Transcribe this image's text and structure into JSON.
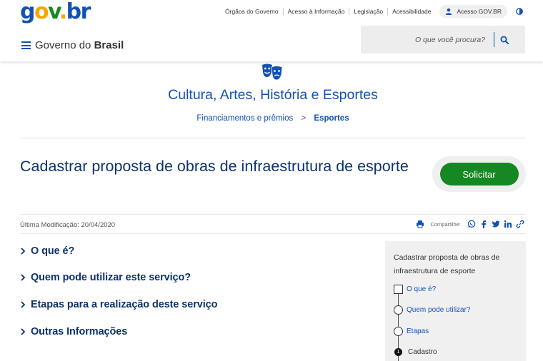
{
  "header": {
    "logo": "gov.br",
    "links": [
      "Órgãos do Governo",
      "Acesso à Informação",
      "Legislação",
      "Acessibilidade"
    ],
    "login_label": "Acesso GOV.BR",
    "menu_prefix": "Governo do",
    "menu_brand": "Brasil",
    "search_placeholder": "O que você procura?"
  },
  "section": {
    "icon": "theatre-masks-icon",
    "title": "Cultura, Artes, História e Esportes",
    "breadcrumb_parent": "Financiamentos e prêmios",
    "breadcrumb_separator": ">",
    "breadcrumb_current": "Esportes"
  },
  "page": {
    "title": "Cadastrar proposta de obras de infraestrutura de esporte",
    "cta_label": "Solicitar",
    "last_modified": "Última Modificação: 20/04/2020",
    "share_label": "Compartilhe:"
  },
  "accordion": [
    {
      "label": "O que é?"
    },
    {
      "label": "Quem pode utilizar este serviço?"
    },
    {
      "label": "Etapas para a realização deste serviço"
    },
    {
      "label": "Outras Informações"
    }
  ],
  "side_nav": {
    "title": "Cadastrar proposta de obras de infraestrutura de esporte",
    "steps": [
      {
        "label": "O que é?"
      },
      {
        "label": "Quem pode utilizar?"
      },
      {
        "label": "Etapas"
      },
      {
        "number": "1",
        "label": "Cadastro"
      }
    ]
  },
  "colors": {
    "primary_blue": "#1351b4",
    "dark_blue": "#0c326f",
    "green": "#168821",
    "yellow": "#f7a600"
  }
}
